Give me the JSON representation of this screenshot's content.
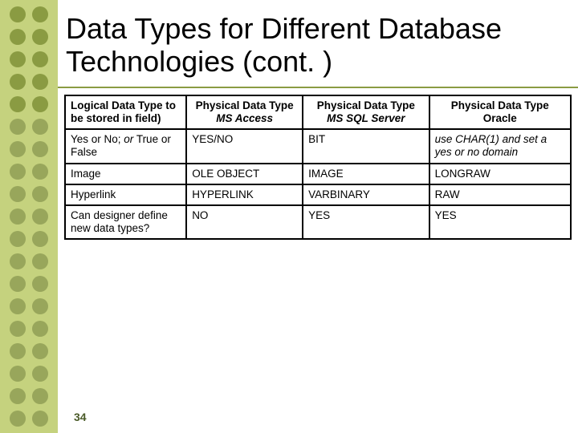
{
  "title": "Data Types for Different Database Technologies (cont. )",
  "page_number": "34",
  "table": {
    "headers": {
      "c0": "Logical Data Type to be stored in field)",
      "c1a": "Physical Data Type",
      "c1b": "MS Access",
      "c2a": "Physical Data Type",
      "c2b": "MS SQL Server",
      "c3a": "Physical Data Type",
      "c3b": "Oracle"
    },
    "rows": [
      {
        "c0_a": "Yes or No; ",
        "c0_b": "or",
        "c0_c": " True or False",
        "c1": "YES/NO",
        "c2": "BIT",
        "c3": "use CHAR(1) and set a yes or no domain",
        "c3_italic": true
      },
      {
        "c0": "Image",
        "c1": "OLE OBJECT",
        "c2": "IMAGE",
        "c3": "LONGRAW"
      },
      {
        "c0": "Hyperlink",
        "c1": "HYPERLINK",
        "c2": "VARBINARY",
        "c3": "RAW"
      },
      {
        "c0": "Can designer define new data types?",
        "c1": "NO",
        "c2": "YES",
        "c3": "YES"
      }
    ]
  }
}
